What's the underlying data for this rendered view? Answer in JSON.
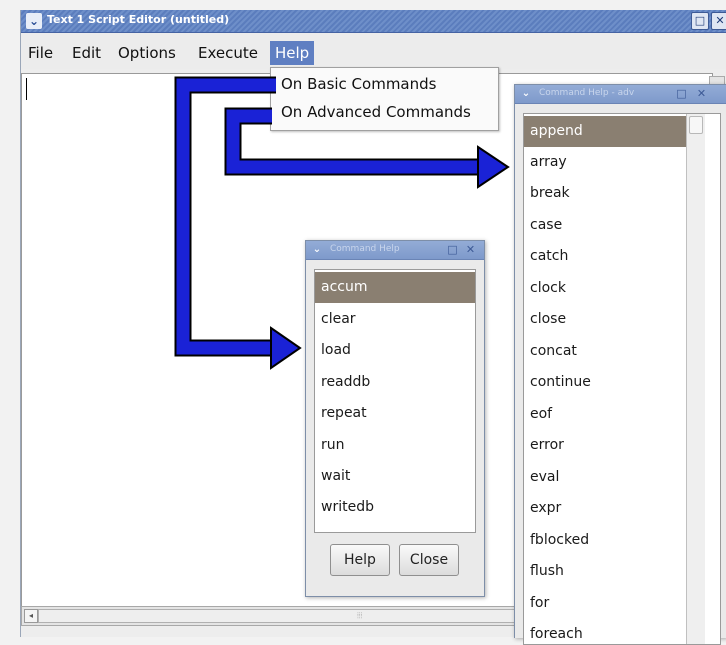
{
  "main_window": {
    "title": "Text 1 Script Editor (untitled)",
    "icon": "chevron-down-icon",
    "buttons": [
      "□",
      "✕"
    ]
  },
  "menubar": {
    "items": [
      "File",
      "Edit",
      "Options",
      "Execute",
      "Help"
    ],
    "active": "Help"
  },
  "help_menu": {
    "items": [
      "On Basic Commands",
      "On Advanced Commands"
    ]
  },
  "basic_help_window": {
    "title": "Command Help",
    "commands": [
      "accum",
      "clear",
      "load",
      "readdb",
      "repeat",
      "run",
      "wait",
      "writedb"
    ],
    "selected": "accum",
    "help_button": "Help",
    "close_button": "Close"
  },
  "advanced_help_window": {
    "title": "Command Help - adv",
    "commands": [
      "append",
      "array",
      "break",
      "case",
      "catch",
      "clock",
      "close",
      "concat",
      "continue",
      "eof",
      "error",
      "eval",
      "expr",
      "fblocked",
      "flush",
      "for",
      "foreach"
    ],
    "selected": "append"
  },
  "colors": {
    "titlebar": "#5f7fc2",
    "selection": "#8a7f71",
    "arrow_fill": "#1a22d6",
    "arrow_outline": "#000000"
  }
}
